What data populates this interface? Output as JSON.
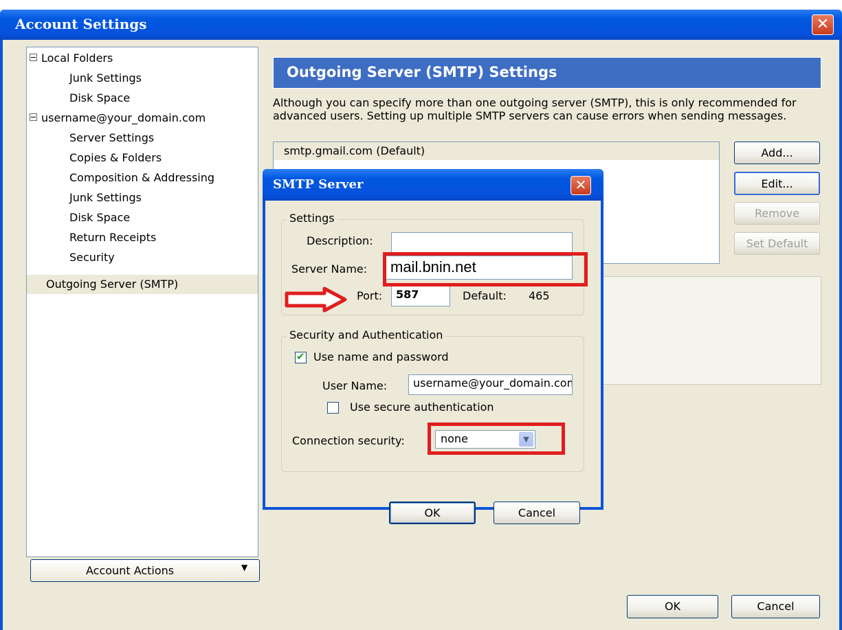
{
  "window": {
    "title": "Account Settings",
    "close_glyph": "✕"
  },
  "tree": {
    "items": [
      {
        "label": "Local Folders",
        "level": 0,
        "expanded": true
      },
      {
        "label": "Junk Settings",
        "level": 1
      },
      {
        "label": "Disk Space",
        "level": 1
      },
      {
        "label": "username@your_domain.com",
        "level": 0,
        "expanded": true
      },
      {
        "label": "Server Settings",
        "level": 1
      },
      {
        "label": "Copies & Folders",
        "level": 1
      },
      {
        "label": "Composition & Addressing",
        "level": 1
      },
      {
        "label": "Junk Settings",
        "level": 1
      },
      {
        "label": "Disk Space",
        "level": 1
      },
      {
        "label": "Return Receipts",
        "level": 1
      },
      {
        "label": "Security",
        "level": 1
      },
      {
        "label": "Outgoing Server (SMTP)",
        "level": 0,
        "selected": true
      }
    ]
  },
  "account_actions": {
    "label": "Account Actions",
    "arrow": "▼"
  },
  "panel": {
    "header": "Outgoing Server (SMTP) Settings",
    "description": "Although you can specify more than one outgoing server (SMTP), this is only recommended for advanced users. Setting up multiple SMTP servers can cause errors when sending messages.",
    "servers": [
      "smtp.gmail.com (Default)"
    ],
    "buttons": {
      "add": "Add...",
      "edit": "Edit...",
      "remove": "Remove",
      "set_default": "Set Default"
    }
  },
  "footer": {
    "ok": "OK",
    "cancel": "Cancel"
  },
  "dialog": {
    "title": "SMTP Server",
    "close_glyph": "✕",
    "settings_group": "Settings",
    "description_label": "Description:",
    "description_value": "",
    "server_name_label": "Server Name:",
    "server_name_value": "mail.bnin.net",
    "port_label": "Port:",
    "port_value": "587",
    "default_label": "Default:",
    "default_value": "465",
    "security_group": "Security and Authentication",
    "use_name_password_label": "Use name and password",
    "use_name_password_checked": true,
    "user_name_label": "User Name:",
    "user_name_value": "username@your_domain.com",
    "secure_auth_label": "Use secure authentication",
    "secure_auth_checked": false,
    "connection_security_label": "Connection security:",
    "connection_security_value": "none",
    "ok": "OK",
    "cancel": "Cancel"
  },
  "colors": {
    "title_bar": "#0058e0",
    "panel_header": "#3e6dc4",
    "annotation_red": "#e01e1e"
  }
}
